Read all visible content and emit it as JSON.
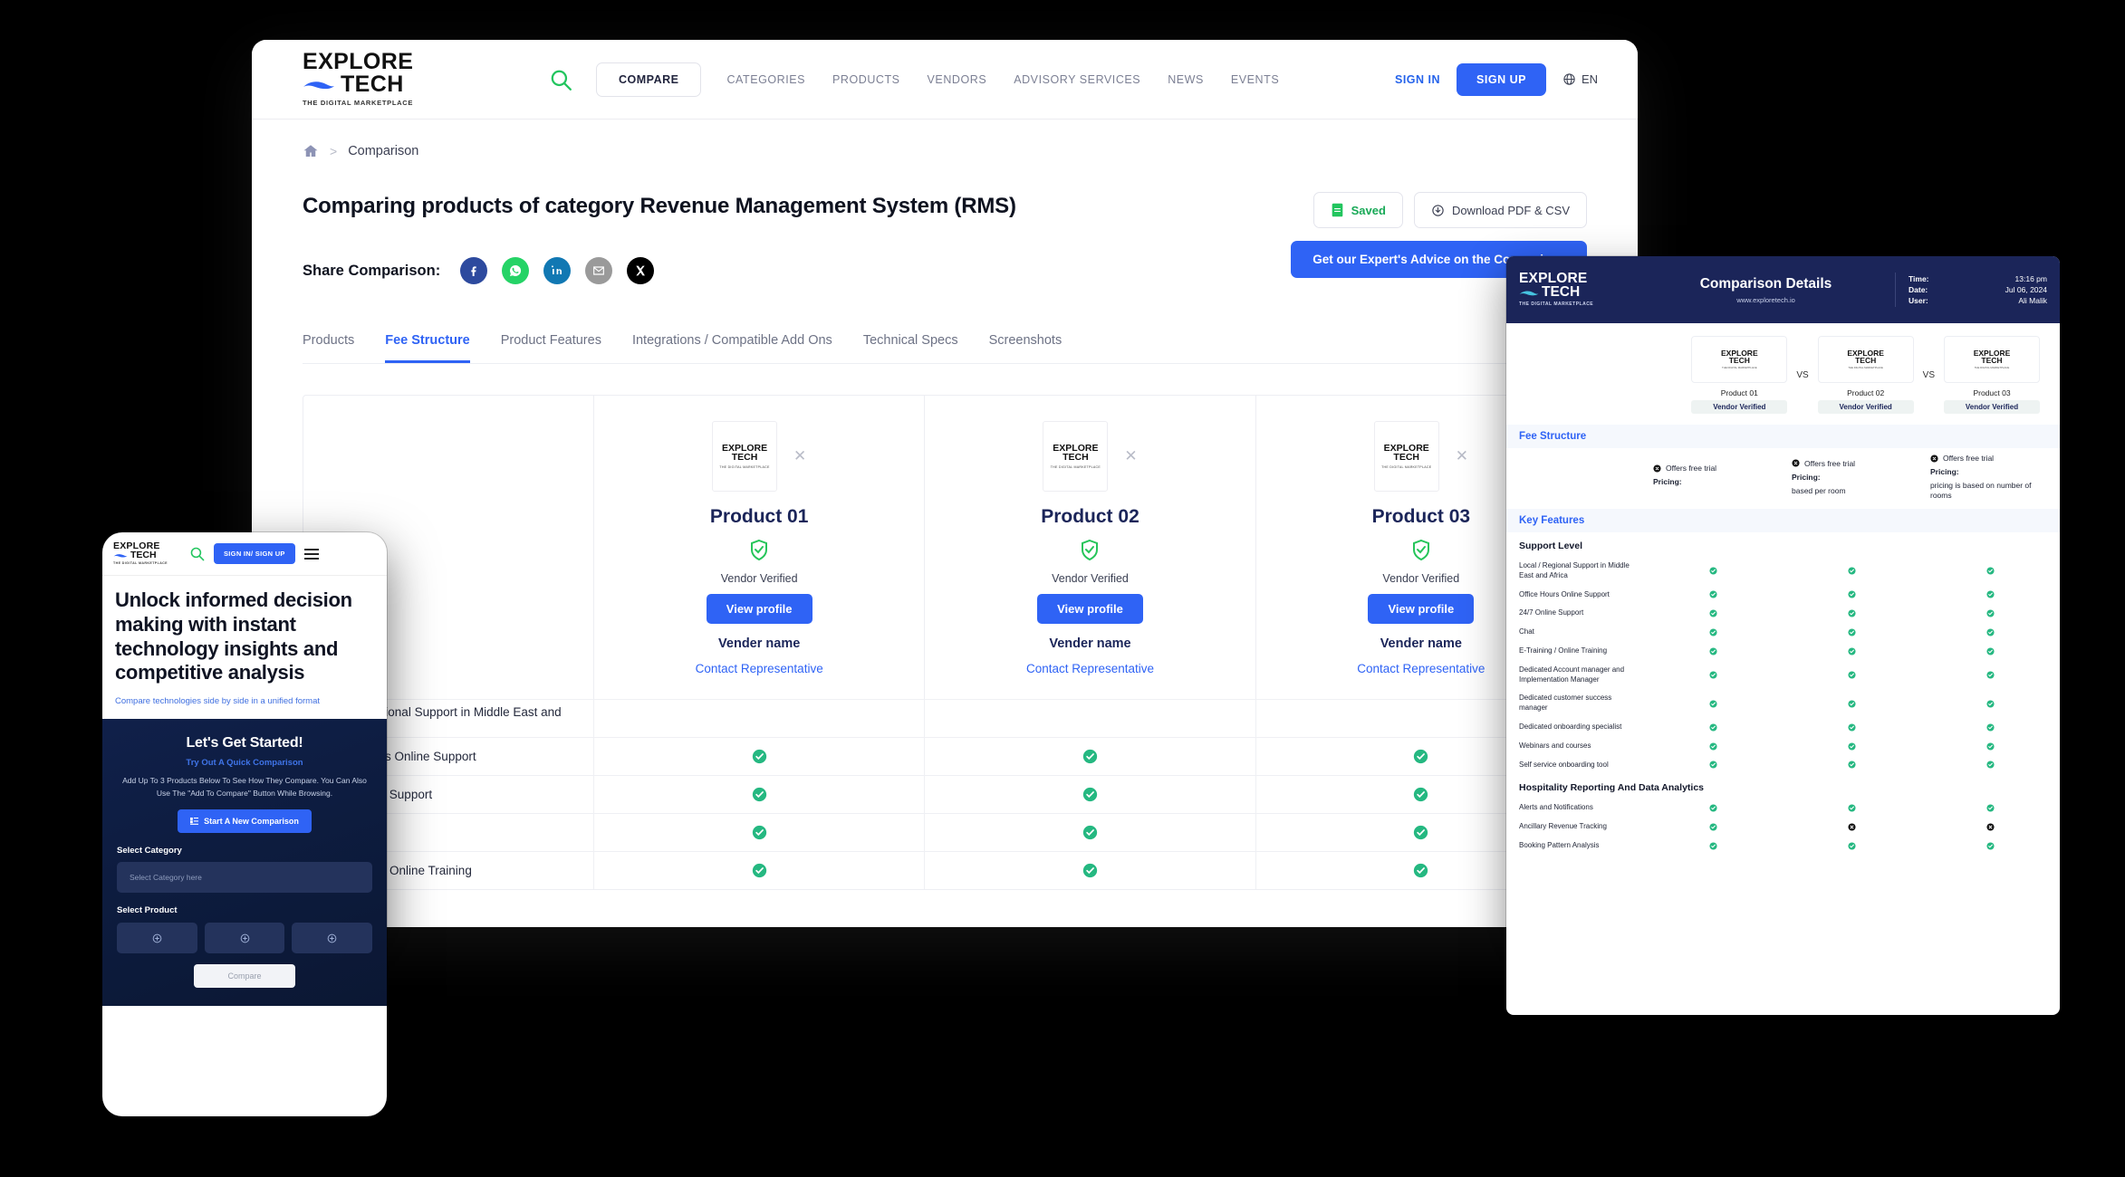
{
  "desktop": {
    "nav": {
      "logo": {
        "line1": "EXPLORE",
        "line2": "TECH",
        "tagline": "THE DIGITAL MARKETPLACE"
      },
      "compare_label": "COMPARE",
      "links": [
        "CATEGORIES",
        "PRODUCTS",
        "VENDORS",
        "ADVISORY SERVICES",
        "NEWS",
        "EVENTS"
      ],
      "signin_label": "SIGN IN",
      "signup_label": "SIGN UP",
      "language": "EN"
    },
    "breadcrumb": {
      "home_icon": "home-icon",
      "separator": ">",
      "current": "Comparison"
    },
    "page_title": "Comparing products of category Revenue Management System (RMS)",
    "actions": {
      "saved_label": "Saved",
      "download_label": "Download PDF & CSV",
      "expert_label": "Get our Expert's Advice on the Comparison"
    },
    "share": {
      "label": "Share Comparison:",
      "networks": [
        "facebook-icon",
        "whatsapp-icon",
        "linkedin-icon",
        "email-icon",
        "x-twitter-icon"
      ]
    },
    "tabs": [
      {
        "label": "Products",
        "active": false
      },
      {
        "label": "Fee Structure",
        "active": true
      },
      {
        "label": "Product Features",
        "active": false
      },
      {
        "label": "Integrations / Compatible Add Ons",
        "active": false
      },
      {
        "label": "Technical Specs",
        "active": false
      },
      {
        "label": "Screenshots",
        "active": false
      }
    ],
    "products": [
      {
        "name": "Product 01",
        "verified_label": "Vendor Verified",
        "view_label": "View profile",
        "vendor_label": "Vender name",
        "contact_label": "Contact Representative"
      },
      {
        "name": "Product 02",
        "verified_label": "Vendor Verified",
        "view_label": "View profile",
        "vendor_label": "Vender name",
        "contact_label": "Contact Representative"
      },
      {
        "name": "Product 03",
        "verified_label": "Vendor Verified",
        "view_label": "View profile",
        "vendor_label": "Vender name",
        "contact_label": "Contact Representative"
      }
    ],
    "feature_rows": [
      {
        "label": "Local / Regional Support in Middle East and Africa",
        "values": [
          "none",
          "none",
          "none"
        ]
      },
      {
        "label": "Office Hours Online Support",
        "values": [
          "check",
          "check",
          "check"
        ]
      },
      {
        "label": "24/7 Online Support",
        "values": [
          "check",
          "check",
          "check"
        ]
      },
      {
        "label": "Chat",
        "values": [
          "check",
          "check",
          "check"
        ]
      },
      {
        "label": "E-Training / Online Training",
        "values": [
          "check",
          "check",
          "check"
        ]
      }
    ]
  },
  "pdf": {
    "header": {
      "logo": {
        "line1": "EXPLORE",
        "line2": "TECH",
        "tagline": "THE DIGITAL MARKETPLACE"
      },
      "title": "Comparison Details",
      "url": "www.exploretech.io",
      "meta": [
        {
          "key": "Time:",
          "value": "13:16 pm"
        },
        {
          "key": "Date:",
          "value": "Jul 06, 2024"
        },
        {
          "key": "User:",
          "value": "Ali Malik"
        }
      ]
    },
    "vs_label": "VS",
    "products": [
      {
        "name": "Product 01",
        "badge": "Vendor Verified"
      },
      {
        "name": "Product 02",
        "badge": "Vendor Verified"
      },
      {
        "name": "Product 03",
        "badge": "Vendor Verified"
      }
    ],
    "fee_section": {
      "title": "Fee Structure",
      "columns": [
        {
          "trial": "Offers free trial",
          "trial_state": "cross",
          "pricing_label": "Pricing:",
          "pricing_value": ""
        },
        {
          "trial": "Offers free trial",
          "trial_state": "cross",
          "pricing_label": "Pricing:",
          "pricing_value": "based per room"
        },
        {
          "trial": "Offers free trial",
          "trial_state": "cross",
          "pricing_label": "Pricing:",
          "pricing_value": "pricing is based on number of rooms"
        }
      ]
    },
    "key_features": {
      "title": "Key Features",
      "groups": [
        {
          "title": "Support Level",
          "rows": [
            {
              "label": "Local / Regional Support in Middle East and Africa",
              "values": [
                "check",
                "check",
                "check"
              ]
            },
            {
              "label": "Office Hours Online Support",
              "values": [
                "check",
                "check",
                "check"
              ]
            },
            {
              "label": "24/7 Online Support",
              "values": [
                "check",
                "check",
                "check"
              ]
            },
            {
              "label": "Chat",
              "values": [
                "check",
                "check",
                "check"
              ]
            },
            {
              "label": "E-Training / Online Training",
              "values": [
                "check",
                "check",
                "check"
              ]
            },
            {
              "label": "Dedicated Account manager and Implementation Manager",
              "values": [
                "check",
                "check",
                "check"
              ]
            },
            {
              "label": "Dedicated customer success manager",
              "values": [
                "check",
                "check",
                "check"
              ]
            },
            {
              "label": "Dedicated onboarding specialist",
              "values": [
                "check",
                "check",
                "check"
              ]
            },
            {
              "label": "Webinars and courses",
              "values": [
                "check",
                "check",
                "check"
              ]
            },
            {
              "label": "Self service onboarding tool",
              "values": [
                "check",
                "check",
                "check"
              ]
            }
          ]
        },
        {
          "title": "Hospitality Reporting And Data Analytics",
          "rows": [
            {
              "label": "Alerts and Notifications",
              "values": [
                "check",
                "check",
                "check"
              ]
            },
            {
              "label": "Ancillary Revenue Tracking",
              "values": [
                "check",
                "cross",
                "cross"
              ]
            },
            {
              "label": "Booking Pattern Analysis",
              "values": [
                "check",
                "check",
                "check"
              ]
            }
          ]
        }
      ]
    }
  },
  "mobile": {
    "nav": {
      "logo": {
        "line1": "EXPLORE",
        "line2": "TECH",
        "tagline": "THE DIGITAL MARKETPLACE"
      },
      "auth_label": "SIGN IN/ SIGN UP",
      "search_icon": "search-icon",
      "menu_icon": "hamburger-icon"
    },
    "hero": {
      "heading": "Unlock informed decision making with instant technology insights and competitive analysis",
      "subheading": "Compare technologies side by side in a unified format"
    },
    "card": {
      "title": "Let's Get Started!",
      "subtitle": "Try Out A Quick Comparison",
      "body": "Add Up To 3 Products Below To See How They Compare. You Can Also Use The \"Add To Compare\" Button While Browsing.",
      "start_button": "Start A New Comparison",
      "category_label": "Select Category",
      "category_placeholder": "Select Category here",
      "product_label": "Select Product",
      "compare_button": "Compare"
    }
  },
  "colors": {
    "brand_blue": "#2f63f5",
    "navy": "#1b2559",
    "green_check": "#25b881",
    "green_logo": "#26c55a",
    "black": "#000000"
  }
}
